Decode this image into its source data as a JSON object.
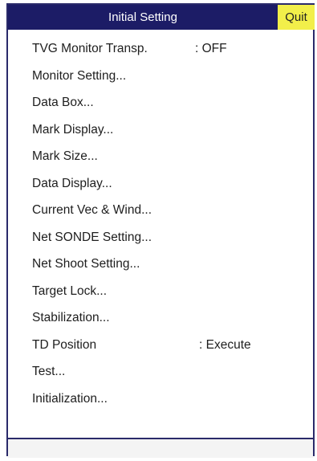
{
  "menu": {
    "title": "Initial Setting",
    "quit_label": "Quit",
    "items": [
      {
        "label": "TVG Monitor Transp.",
        "value": ": OFF"
      },
      {
        "label": "Monitor Setting..."
      },
      {
        "label": "Data Box..."
      },
      {
        "label": "Mark Display..."
      },
      {
        "label": "Mark Size..."
      },
      {
        "label": "Data Display..."
      },
      {
        "label": "Current Vec & Wind..."
      },
      {
        "label": "Net SONDE Setting..."
      },
      {
        "label": "Net Shoot Setting..."
      },
      {
        "label": "Target Lock..."
      },
      {
        "label": "Stabilization..."
      },
      {
        "label": "TD Position",
        "value": ": Execute"
      },
      {
        "label": "Test..."
      },
      {
        "label": "Initialization..."
      }
    ]
  },
  "colors": {
    "title_bar": "#1c1c66",
    "quit_button": "#f2ef4a",
    "text": "#1e1e1e",
    "background": "#ffffff"
  }
}
